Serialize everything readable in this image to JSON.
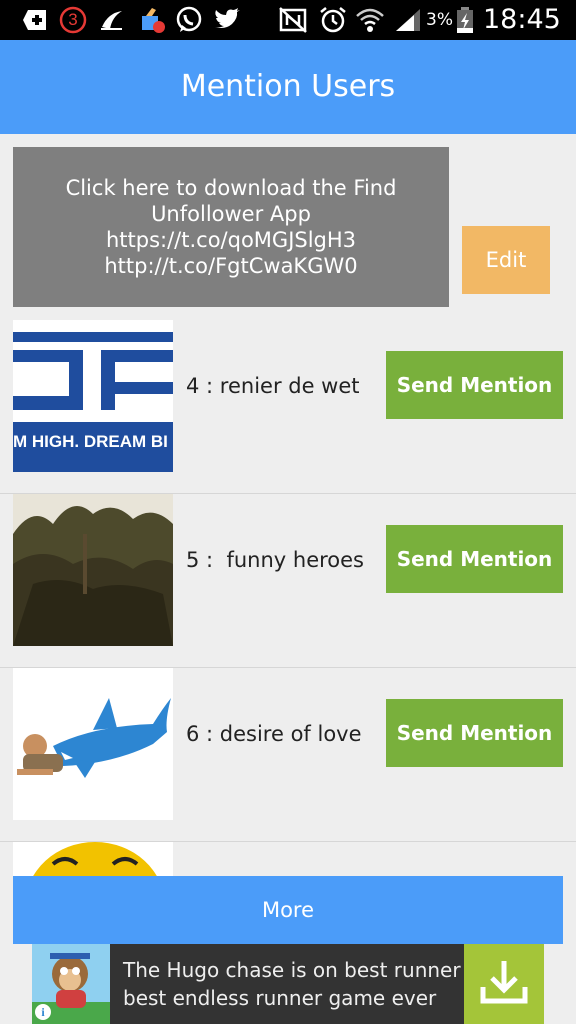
{
  "status_bar": {
    "battery": "3%",
    "time": "18:45",
    "notification_count": "3"
  },
  "app_bar": {
    "title": "Mention Users"
  },
  "promo": {
    "text": "Click here to download the Find Unfollower App https://t.co/qoMGJSlgH3 http://t.co/FgtCwaKGW0",
    "edit_label": "Edit"
  },
  "users": [
    {
      "label": "4 : renier de wet",
      "button": "Send Mention",
      "avatar_caption": "M HIGH. DREAM BI"
    },
    {
      "label": "5 :  funny heroes",
      "button": "Send Mention"
    },
    {
      "label": "6 : desire of love",
      "button": "Send Mention"
    }
  ],
  "more_label": "More",
  "ad": {
    "line1": "The Hugo chase is on best runner",
    "line2": "best endless runner game ever"
  },
  "colors": {
    "app_bar": "#4b9cf9",
    "send_button": "#79b03c",
    "edit_button": "#f2b865",
    "promo_bg": "#7f7f7f",
    "ad_download": "#a4c539"
  }
}
